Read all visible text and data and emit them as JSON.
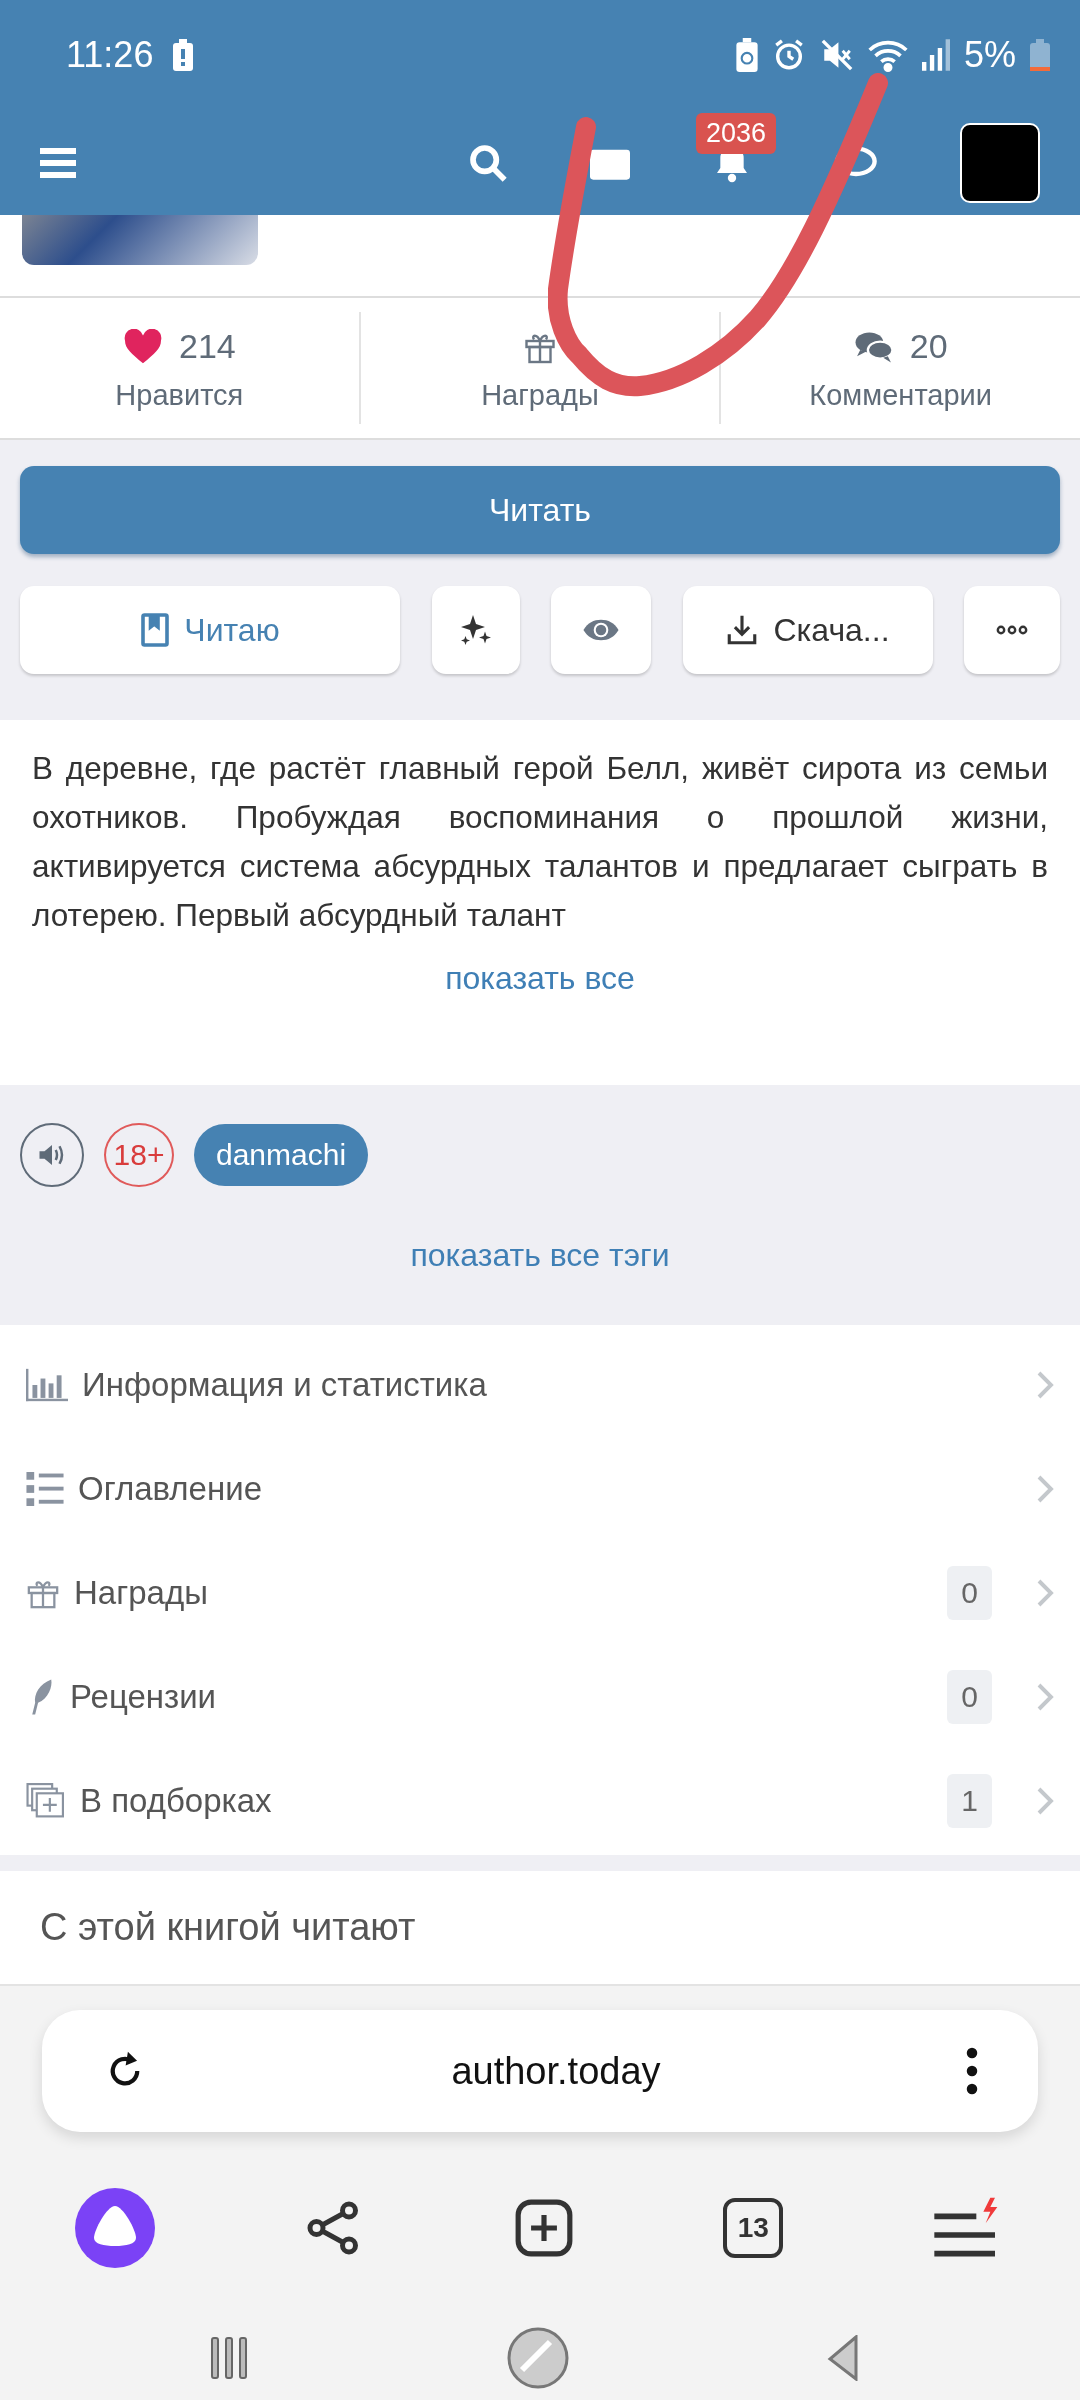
{
  "status_bar": {
    "time": "11:26",
    "battery": "5%"
  },
  "header": {
    "notification_count": "2036"
  },
  "stats": [
    {
      "kind": "likes",
      "value": "214",
      "label": "Нравится"
    },
    {
      "kind": "awards",
      "label": "Награды"
    },
    {
      "kind": "comments",
      "value": "20",
      "label": "Комментарии"
    }
  ],
  "read_button": "Читать",
  "actions": [
    {
      "kind": "reading",
      "label": "Читаю"
    },
    {
      "kind": "sparkle"
    },
    {
      "kind": "eye"
    },
    {
      "kind": "download",
      "label": "Скача..."
    },
    {
      "kind": "more"
    }
  ],
  "description": {
    "text": "В деревне, где растёт главный герой Белл, живёт сирота из семьи охотников. Пробуждая воспоминания о прошлой жизни, активируется система абсурдных талантов и предлагает сыграть в лотерею. Первый абсурдный талант",
    "show_all": "показать все"
  },
  "tags": {
    "age_rating": "18+",
    "items": [
      "danmachi"
    ],
    "show_all": "показать все тэги"
  },
  "menu": [
    {
      "kind": "stats",
      "label": "Информация и статистика"
    },
    {
      "kind": "contents",
      "label": "Оглавление"
    },
    {
      "kind": "awards",
      "label": "Награды",
      "count": "0"
    },
    {
      "kind": "reviews",
      "label": "Рецензии",
      "count": "0"
    },
    {
      "kind": "collections",
      "label": "В подборках",
      "count": "1"
    }
  ],
  "section_title": "С этой книгой читают",
  "browser": {
    "url": "author.today",
    "tabs_count": "13"
  }
}
